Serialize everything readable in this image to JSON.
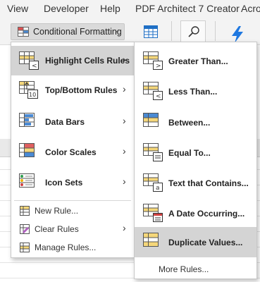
{
  "menubar": {
    "items": [
      "View",
      "Developer",
      "Help",
      "PDF Architect 7 Creator",
      "Acro"
    ]
  },
  "ribbon": {
    "conditional_formatting_label": "Conditional Formatting",
    "dropdown_glyph": "⌄"
  },
  "main_menu": {
    "items": [
      {
        "label": "Highlight Cells Rules",
        "icon": "highlight-cells-icon",
        "has_submenu": true,
        "highlighted": true
      },
      {
        "label": "Top/Bottom Rules",
        "icon": "top-bottom-icon",
        "has_submenu": true,
        "highlighted": false
      },
      {
        "label": "Data Bars",
        "icon": "data-bars-icon",
        "has_submenu": true,
        "highlighted": false
      },
      {
        "label": "Color Scales",
        "icon": "color-scales-icon",
        "has_submenu": true,
        "highlighted": false
      },
      {
        "label": "Icon Sets",
        "icon": "icon-sets-icon",
        "has_submenu": true,
        "highlighted": false
      }
    ],
    "small_items": [
      {
        "label": "New Rule...",
        "icon": "new-rule-icon",
        "has_submenu": false
      },
      {
        "label": "Clear Rules",
        "icon": "clear-rules-icon",
        "has_submenu": true
      },
      {
        "label": "Manage Rules...",
        "icon": "manage-rules-icon",
        "has_submenu": false
      }
    ],
    "arrow_glyph": "›"
  },
  "sub_menu": {
    "items": [
      {
        "label": "Greater Than...",
        "icon": "greater-than-icon",
        "highlighted": false
      },
      {
        "label": "Less Than...",
        "icon": "less-than-icon",
        "highlighted": false
      },
      {
        "label": "Between...",
        "icon": "between-icon",
        "highlighted": false
      },
      {
        "label": "Equal To...",
        "icon": "equal-to-icon",
        "highlighted": false
      },
      {
        "label": "Text that Contains...",
        "icon": "text-contains-icon",
        "highlighted": false
      },
      {
        "label": "A Date Occurring...",
        "icon": "date-occurring-icon",
        "highlighted": false
      },
      {
        "label": "Duplicate Values...",
        "icon": "duplicate-values-icon",
        "highlighted": true
      }
    ],
    "more_rules_label": "More Rules..."
  },
  "colors": {
    "ribbon_bg": "#f3f3f3",
    "highlight_bg": "#d4d4d4",
    "cell_yellow": "#f5d77a",
    "cell_blue": "#4a8ad4",
    "accent_blue": "#1f6fc5"
  }
}
